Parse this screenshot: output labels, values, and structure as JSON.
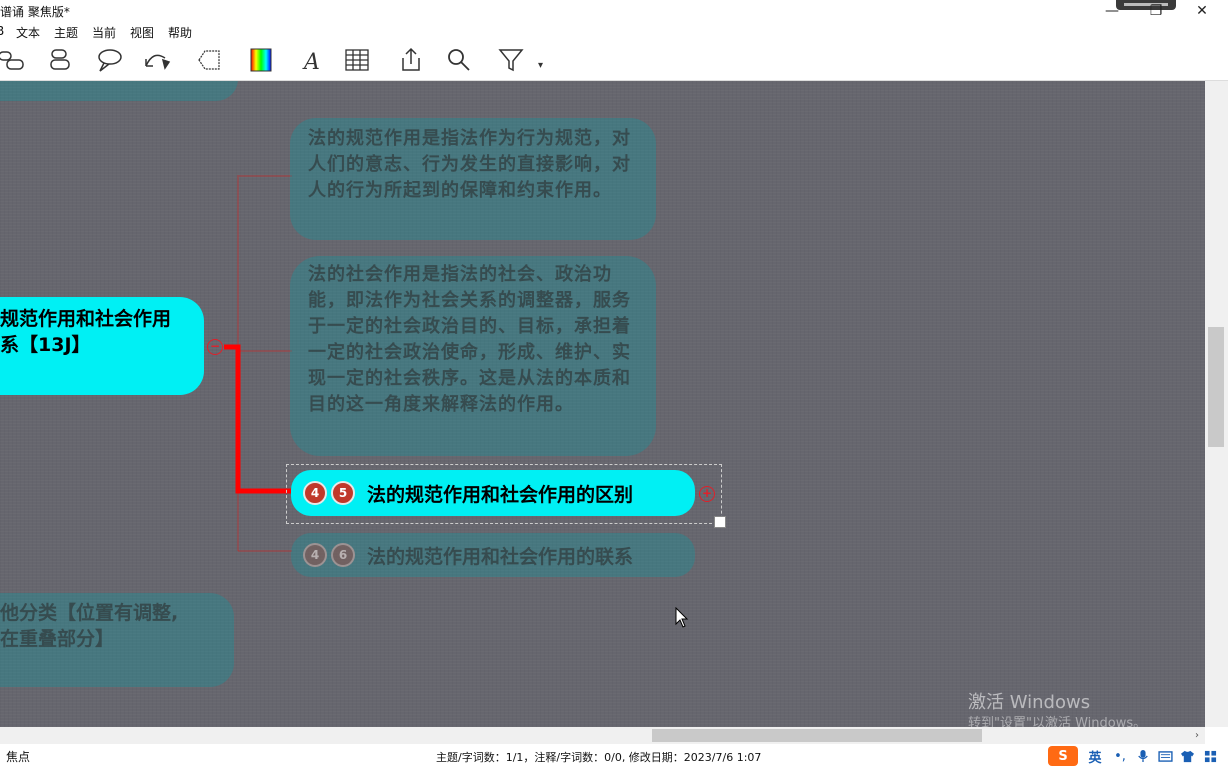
{
  "window": {
    "title": "谱诵 聚焦版*",
    "minimize": "—",
    "maximize": "❐",
    "close": "✕"
  },
  "menu": {
    "items": [
      "B",
      "文本",
      "主题",
      "当前",
      "视图",
      "帮助"
    ]
  },
  "toolbar": {
    "icons": [
      "relationship-icon",
      "callout-icon",
      "boundary-icon",
      "undo-redo-icon",
      "shape-icon",
      "color-icon",
      "font-icon",
      "table-icon",
      "export-icon",
      "search-icon",
      "filter-icon"
    ],
    "more": "▾"
  },
  "map": {
    "top_faded_node": "",
    "central_node_line1": "规范作用和社会作用",
    "central_node_line2": "系【13J】",
    "note_1": "法的规范作用是指法作为行为规范，对人们的意志、行为发生的直接影响，对人的行为所起到的保障和约束作用。",
    "note_2": "法的社会作用是指法的社会、政治功能，即法作为社会关系的调整器，服务于一定的社会政治目的、目标，承担着一定的社会政治使命，形成、维护、实现一定的社会秩序。这是从法的本质和目的这一角度来解释法的作用。",
    "active_badge_1": "4",
    "active_badge_2": "5",
    "active_node": "法的规范作用和社会作用的区别",
    "faded_badge_1": "4",
    "faded_badge_2": "6",
    "faded_node": "法的规范作用和社会作用的联系",
    "bottom_node_line1": "他分类【位置有调整,",
    "bottom_node_line2": "在重叠部分】",
    "collapse_symbol": "−",
    "expand_symbol": "+"
  },
  "watermark": {
    "line1": "激活 Windows",
    "line2": "转到\"设置\"以激活 Windows。"
  },
  "status": {
    "left": "焦点",
    "center": "主题/字词数：1/1，注释/字词数：0/0, 修改日期：2023/7/6 1:07"
  },
  "ime": {
    "lang": "英",
    "punct": "•,",
    "mic": "mic-icon",
    "keyboard": "keyboard-icon",
    "skin": "shirt-icon",
    "apps": "grid-icon"
  },
  "colors": {
    "canvas": "#66666e",
    "active_node": "#00f0f4",
    "connector": "#ff0000",
    "faded_node": "#4e8f94"
  }
}
